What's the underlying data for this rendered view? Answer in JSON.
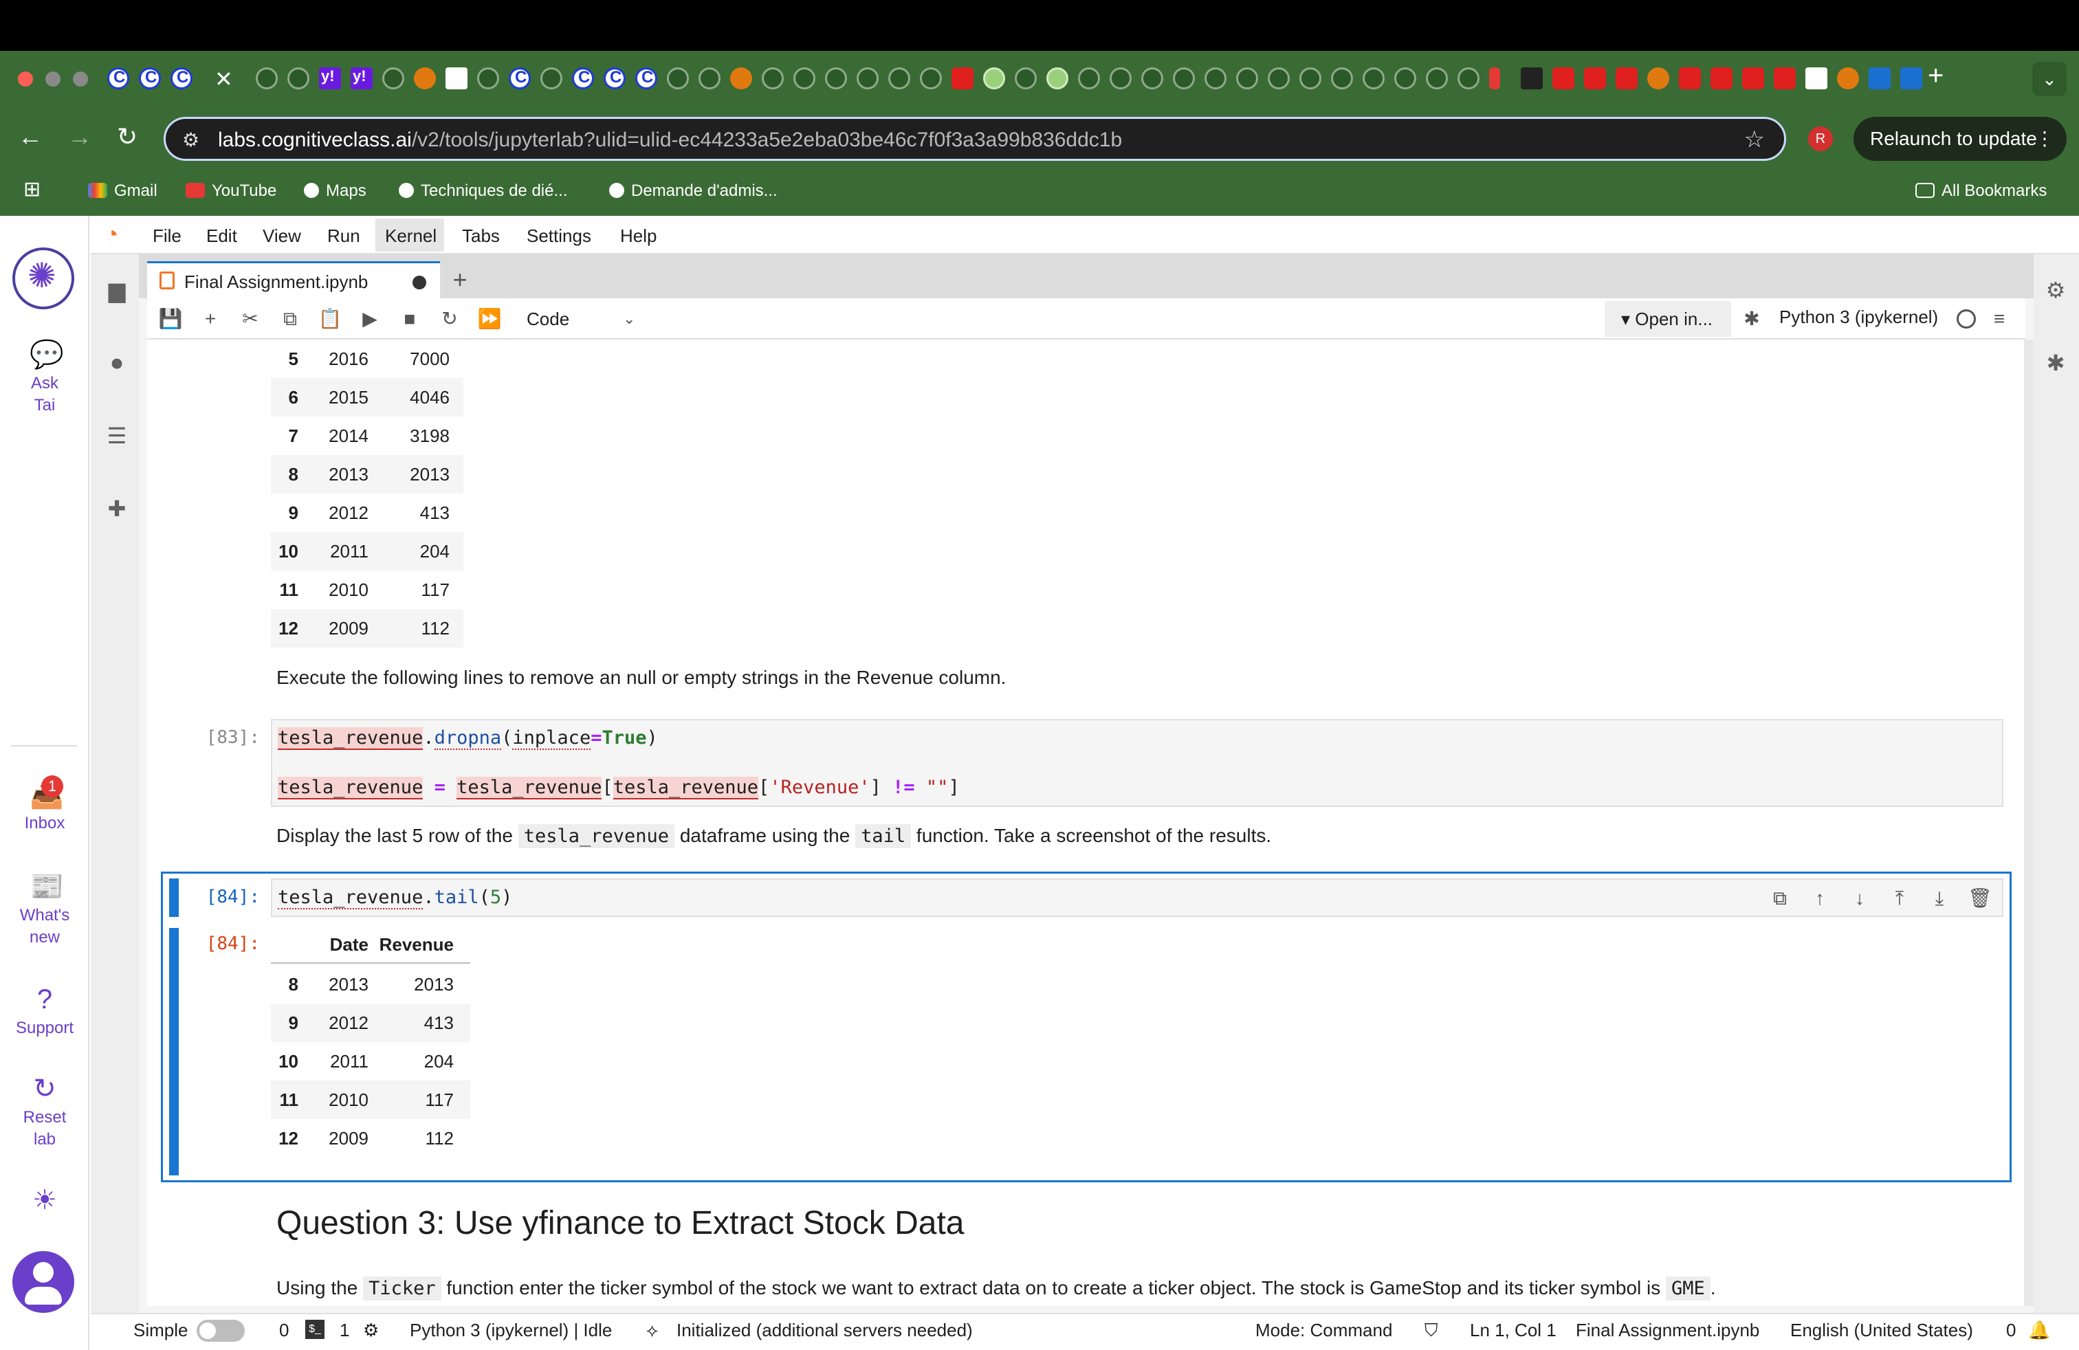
{
  "browser": {
    "url_host": "labs.cognitiveclass.ai",
    "url_path": "/v2/tools/jupyterlab?ulid=ulid-ec44233a5e2eba03be46c7f0f3a3a99b836ddc1b",
    "profile_initial": "R",
    "relaunch_label": "Relaunch to update",
    "bookmarks": [
      "Gmail",
      "YouTube",
      "Maps",
      "Techniques de dié...",
      "Demande d'admis..."
    ],
    "all_bookmarks_label": "All Bookmarks"
  },
  "left_panel": {
    "ask_tai": "Ask\nTai",
    "inbox": "Inbox",
    "inbox_badge": "1",
    "whats_new": "What's\nnew",
    "support": "Support",
    "reset_lab": "Reset\nlab"
  },
  "menu": [
    "File",
    "Edit",
    "View",
    "Run",
    "Kernel",
    "Tabs",
    "Settings",
    "Help"
  ],
  "document_tab": "Final Assignment.ipynb",
  "toolbar": {
    "cell_type": "Code",
    "open_in": "Open in...",
    "kernel": "Python 3 (ipykernel)"
  },
  "notebook": {
    "table1_rows": [
      {
        "idx": "5",
        "date": "2016",
        "rev": "7000"
      },
      {
        "idx": "6",
        "date": "2015",
        "rev": "4046"
      },
      {
        "idx": "7",
        "date": "2014",
        "rev": "3198"
      },
      {
        "idx": "8",
        "date": "2013",
        "rev": "2013"
      },
      {
        "idx": "9",
        "date": "2012",
        "rev": "413"
      },
      {
        "idx": "10",
        "date": "2011",
        "rev": "204"
      },
      {
        "idx": "11",
        "date": "2010",
        "rev": "117"
      },
      {
        "idx": "12",
        "date": "2009",
        "rev": "112"
      }
    ],
    "md1": "Execute the following lines to remove an null or empty strings in the Revenue column.",
    "cell83_prompt": "[83]:",
    "md2_a": "Display the last 5 row of the ",
    "md2_code1": "tesla_revenue",
    "md2_b": " dataframe using the ",
    "md2_code2": "tail",
    "md2_c": " function. Take a screenshot of the results.",
    "cell84_in": "[84]:",
    "cell84_out": "[84]:",
    "table2_headers": [
      "Date",
      "Revenue"
    ],
    "table2_rows": [
      {
        "idx": "8",
        "date": "2013",
        "rev": "2013"
      },
      {
        "idx": "9",
        "date": "2012",
        "rev": "413"
      },
      {
        "idx": "10",
        "date": "2011",
        "rev": "204"
      },
      {
        "idx": "11",
        "date": "2010",
        "rev": "117"
      },
      {
        "idx": "12",
        "date": "2009",
        "rev": "112"
      }
    ],
    "q3_heading": "Question 3: Use yfinance to Extract Stock Data",
    "md3_a": "Using the ",
    "md3_code1": "Ticker",
    "md3_b": " function enter the ticker symbol of the stock we want to extract data on to create a ticker object. The stock is GameStop and its ticker symbol is ",
    "md3_code2": "GME",
    "md3_c": "."
  },
  "statusbar": {
    "simple": "Simple",
    "zero": "0",
    "one": "1",
    "kernel_status": "Python 3 (ipykernel) | Idle",
    "init": "Initialized (additional servers needed)",
    "mode": "Mode: Command",
    "position": "Ln 1, Col 1",
    "file": "Final Assignment.ipynb",
    "language": "English (United States)",
    "notif_count": "0"
  }
}
